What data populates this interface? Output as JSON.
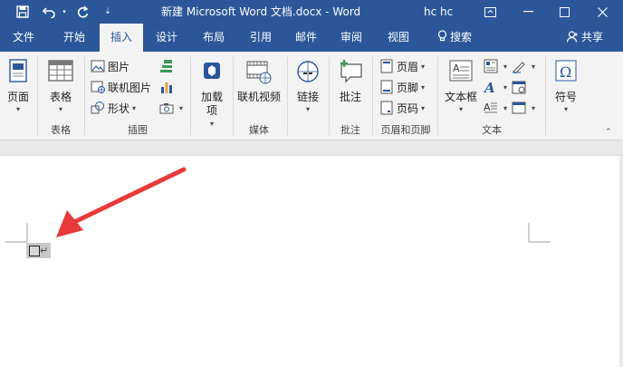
{
  "window": {
    "title": "新建 Microsoft Word 文档.docx  -  Word",
    "user": "hc hc"
  },
  "tabs": [
    {
      "label": "文件"
    },
    {
      "label": "开始"
    },
    {
      "label": "插入",
      "active": true
    },
    {
      "label": "设计"
    },
    {
      "label": "布局"
    },
    {
      "label": "引用"
    },
    {
      "label": "邮件"
    },
    {
      "label": "审阅"
    },
    {
      "label": "视图"
    }
  ],
  "search": {
    "label": "搜索"
  },
  "share": {
    "label": "共享"
  },
  "ribbon": {
    "page": {
      "label": "页面"
    },
    "table": {
      "label": "表格",
      "group": "表格"
    },
    "illustrations": {
      "group": "插图",
      "pictures": "图片",
      "online_pictures": "联机图片",
      "shapes": "形状"
    },
    "addins": {
      "label1": "加载",
      "label2": "项"
    },
    "media": {
      "label": "联机视频",
      "group": "媒体"
    },
    "links": {
      "label": "链接"
    },
    "comments": {
      "label": "批注",
      "group": "批注"
    },
    "header_footer": {
      "group": "页眉和页脚",
      "header": "页眉",
      "footer": "页脚",
      "page_number": "页码"
    },
    "text": {
      "label": "文本框",
      "group": "文本"
    },
    "symbols": {
      "label": "符号"
    }
  },
  "colors": {
    "brand": "#2b579a",
    "ribbon_bg": "#f3f3f3",
    "arrow": "#e83a3a"
  }
}
